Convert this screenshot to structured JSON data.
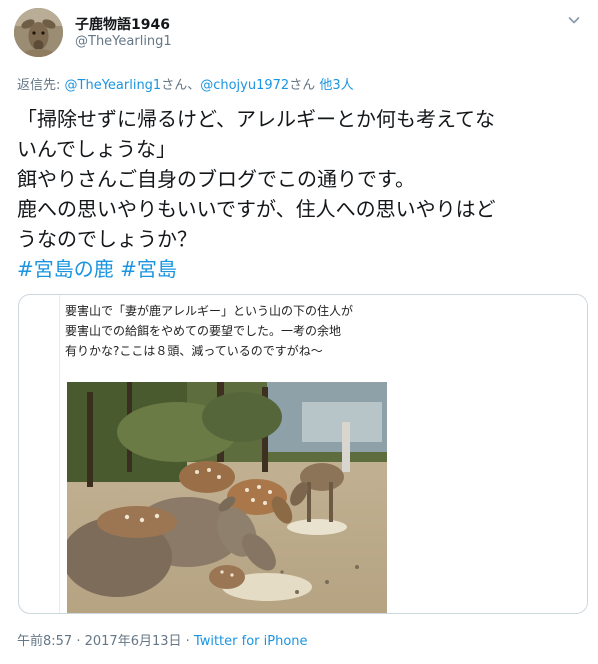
{
  "author": {
    "display_name": "子鹿物語1946",
    "handle": "@TheYearling1"
  },
  "reply": {
    "prefix": "返信先: ",
    "user1": "@TheYearling1",
    "suffix1": "さん、",
    "user2": "@chojyu1972",
    "suffix2": "さん ",
    "others": "他3人"
  },
  "tweet": {
    "lines": [
      "「掃除せずに帰るけど、アレルギーとか何も考えてな",
      "いんでしょうな」",
      "餌やりさんご自身のブログでこの通りです。",
      "鹿への思いやりもいいですが、住人への思いやりはど",
      "うなのでしょうか？"
    ],
    "hashtags": [
      "#宮島の鹿",
      "#宮島"
    ]
  },
  "card": {
    "blog_lines": [
      "要害山で「妻が鹿アレルギー」という山の下の住人が",
      "要害山での給餌をやめての要望でした。一考の余地",
      "有りかな?ここは８頭、減っているのですがね～"
    ]
  },
  "footer": {
    "time": "午前8:57",
    "separator": " · ",
    "date": "2017年6月13日",
    "separator2": " · ",
    "via": "Twitter for iPhone"
  },
  "icons": {
    "caret": "chevron-down-icon",
    "avatar": "deer-avatar"
  },
  "colors": {
    "link": "#1b95e0",
    "secondary_text": "#657786",
    "primary_text": "#14171a",
    "border": "#ccd6dd"
  }
}
